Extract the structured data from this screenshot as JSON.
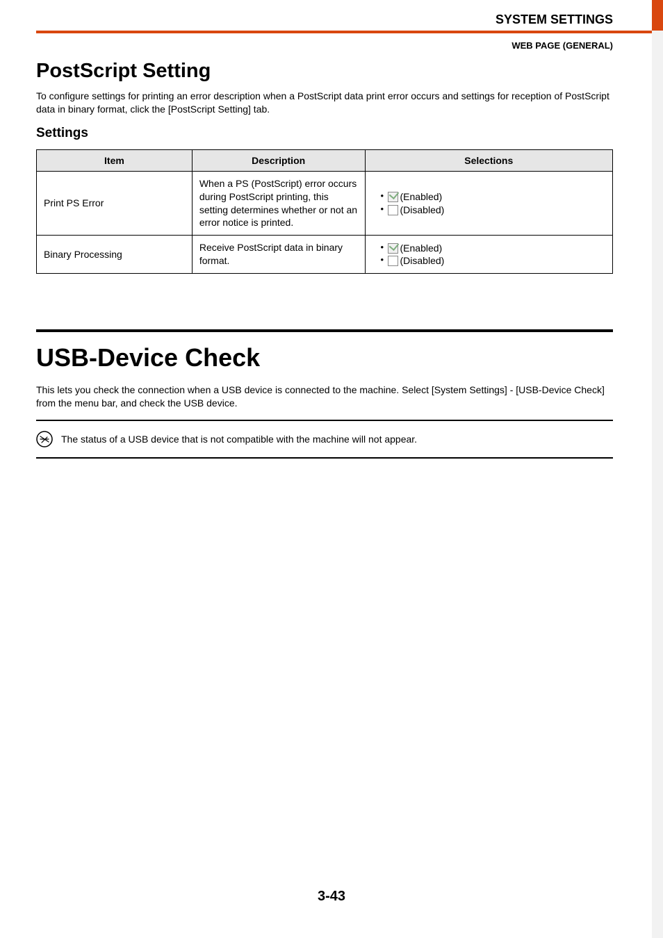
{
  "header": {
    "title": "SYSTEM SETTINGS",
    "breadcrumb": "WEB PAGE (GENERAL)"
  },
  "section1": {
    "heading": "PostScript Setting",
    "intro": "To configure settings for printing an error description when a PostScript data print error occurs and settings for reception of PostScript data in binary format, click the [PostScript Setting] tab.",
    "subheading": "Settings",
    "table": {
      "headers": {
        "item": "Item",
        "description": "Description",
        "selections": "Selections"
      },
      "rows": [
        {
          "item": "Print PS Error",
          "description": "When a PS (PostScript) error occurs during PostScript printing, this setting determines whether or not an error notice is printed.",
          "selections": [
            {
              "label": "(Enabled)",
              "checked": true
            },
            {
              "label": "(Disabled)",
              "checked": false
            }
          ]
        },
        {
          "item": "Binary Processing",
          "description": "Receive PostScript data in binary format.",
          "selections": [
            {
              "label": "(Enabled)",
              "checked": true
            },
            {
              "label": "(Disabled)",
              "checked": false
            }
          ]
        }
      ]
    }
  },
  "section2": {
    "heading": "USB-Device Check",
    "intro": "This lets you check the connection when a USB device is connected to the machine. Select [System Settings] - [USB-Device Check] from the menu bar, and check the USB device.",
    "note": "The status of a USB device that is not compatible with the machine will not appear."
  },
  "page_number": "3-43"
}
